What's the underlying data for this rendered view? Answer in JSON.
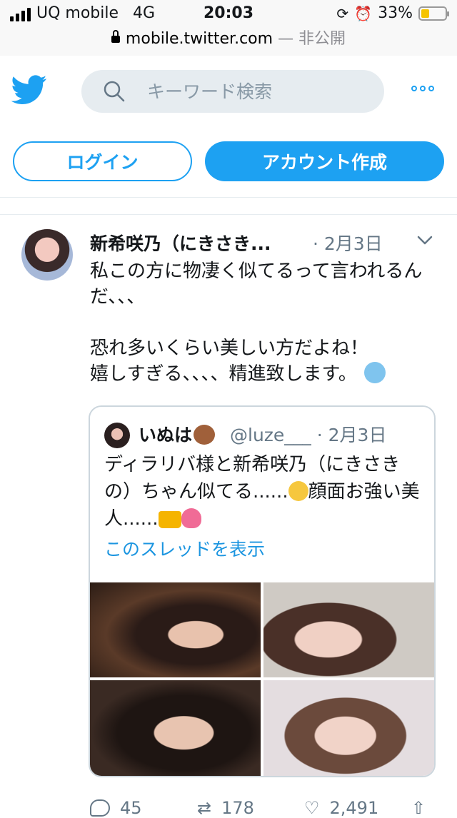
{
  "status_bar": {
    "carrier": "UQ mobile",
    "network": "4G",
    "time": "20:03",
    "battery": "33%",
    "battery_level": 0.33
  },
  "url_bar": {
    "domain": "mobile.twitter.com",
    "privacy": "— 非公開"
  },
  "header": {
    "search_placeholder": "キーワード検索",
    "login_label": "ログイン",
    "signup_label": "アカウント作成"
  },
  "tweet": {
    "author": "新希咲乃（にきさき...",
    "date": "· 2月3日",
    "text_line1": "私この方に物凄く似てるって言われるんだ、、、",
    "text_line2": "恐れ多いくらい美しい方だよね！",
    "text_line3": "嬉しすぎる、、、、精進致します。",
    "quoted": {
      "name": "いぬは",
      "handle": "@luze___",
      "date": "· 2月3日",
      "text_a": "ディラリバ様と新希咲乃（にきさきの）ちゃん似てる......",
      "text_b": "顔面お強い美人......",
      "thread_link": "このスレッドを表示"
    },
    "actions": {
      "replies": "45",
      "retweets": "178",
      "likes": "2,491"
    }
  },
  "colors": {
    "accent": "#1da1f2",
    "muted": "#657786"
  }
}
